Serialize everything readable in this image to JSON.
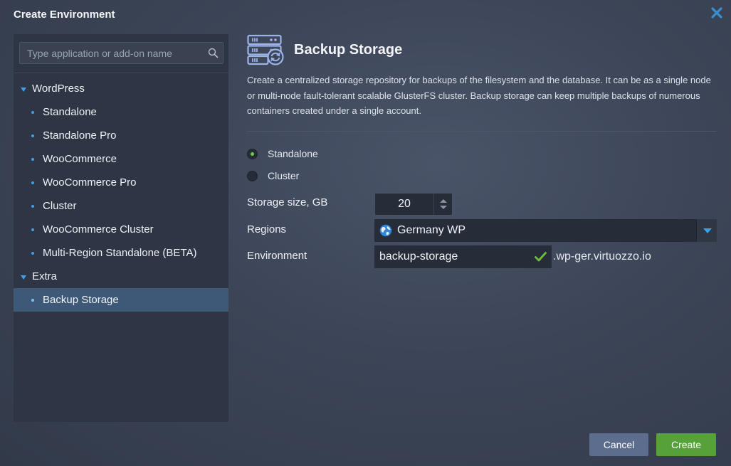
{
  "window": {
    "title": "Create Environment",
    "close_icon": "close-icon"
  },
  "sidebar": {
    "search_placeholder": "Type application or add-on name",
    "groups": [
      {
        "label": "WordPress",
        "items": [
          {
            "label": "Standalone"
          },
          {
            "label": "Standalone Pro"
          },
          {
            "label": "WooCommerce"
          },
          {
            "label": "WooCommerce Pro"
          },
          {
            "label": "Cluster"
          },
          {
            "label": "WooCommerce Cluster"
          },
          {
            "label": "Multi-Region Standalone (BETA)"
          }
        ]
      },
      {
        "label": "Extra",
        "items": [
          {
            "label": "Backup Storage",
            "selected": true
          }
        ]
      }
    ]
  },
  "main": {
    "icon": "storage-server-icon",
    "title": "Backup Storage",
    "description": "Create a centralized storage repository for backups of the filesystem and the database. It can be as a single node or multi-node fault-tolerant scalable GlusterFS cluster. Backup storage can keep multiple backups of numerous containers created under a single account.",
    "topology": {
      "options": [
        {
          "label": "Standalone",
          "selected": true
        },
        {
          "label": "Cluster",
          "selected": false
        }
      ]
    },
    "storage": {
      "label": "Storage size, GB",
      "value": "20"
    },
    "regions": {
      "label": "Regions",
      "value": "Germany WP",
      "icon": "globe-icon"
    },
    "environment": {
      "label": "Environment",
      "value": "backup-storage",
      "suffix": ".wp-ger.virtuozzo.io",
      "valid": true
    }
  },
  "footer": {
    "cancel_label": "Cancel",
    "create_label": "Create"
  },
  "colors": {
    "accent_blue": "#3da0e6",
    "success_green": "#78c44a",
    "create_button": "#57a13a",
    "cancel_button": "#5c6d8d",
    "selected_row": "#3e5977"
  }
}
